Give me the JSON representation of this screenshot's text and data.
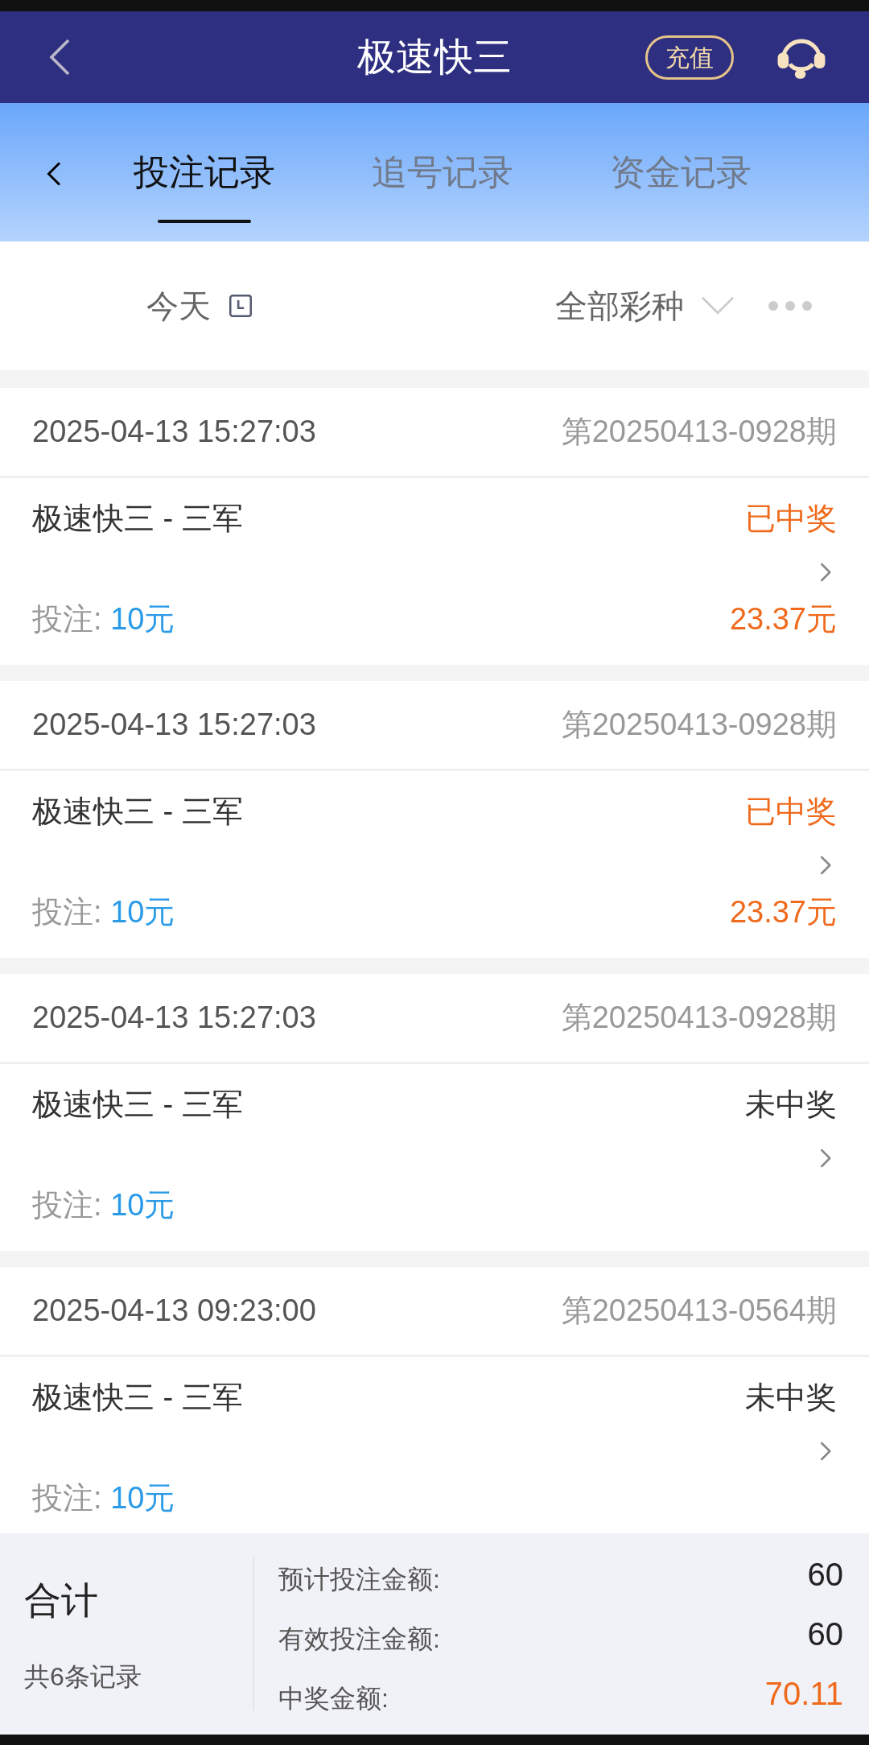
{
  "header": {
    "title": "极速快三",
    "recharge": "充值"
  },
  "tabs": [
    {
      "label": "投注记录",
      "selected": true
    },
    {
      "label": "追号记录",
      "selected": false
    },
    {
      "label": "资金记录",
      "selected": false
    }
  ],
  "filters": {
    "date": "今天",
    "lottery": "全部彩种"
  },
  "records": [
    {
      "time": "2025-04-13 15:27:03",
      "issue": "第20250413-0928期",
      "game": "极速快三 - 三军",
      "won": true,
      "status": "已中奖",
      "bet_label": "投注:",
      "bet": "10元",
      "prize": "23.37元"
    },
    {
      "time": "2025-04-13 15:27:03",
      "issue": "第20250413-0928期",
      "game": "极速快三 - 三军",
      "won": true,
      "status": "已中奖",
      "bet_label": "投注:",
      "bet": "10元",
      "prize": "23.37元"
    },
    {
      "time": "2025-04-13 15:27:03",
      "issue": "第20250413-0928期",
      "game": "极速快三 - 三军",
      "won": false,
      "status": "未中奖",
      "bet_label": "投注:",
      "bet": "10元"
    },
    {
      "time": "2025-04-13 09:23:00",
      "issue": "第20250413-0564期",
      "game": "极速快三 - 三军",
      "won": false,
      "status": "未中奖",
      "bet_label": "投注:",
      "bet": "10元"
    }
  ],
  "summary": {
    "title": "合计",
    "count": "共6条记录",
    "rows": [
      {
        "label": "预计投注金额:",
        "value": "60",
        "highlight": false
      },
      {
        "label": "有效投注金额:",
        "value": "60",
        "highlight": false
      },
      {
        "label": "中奖金额:",
        "value": "70.11",
        "highlight": true
      }
    ]
  }
}
